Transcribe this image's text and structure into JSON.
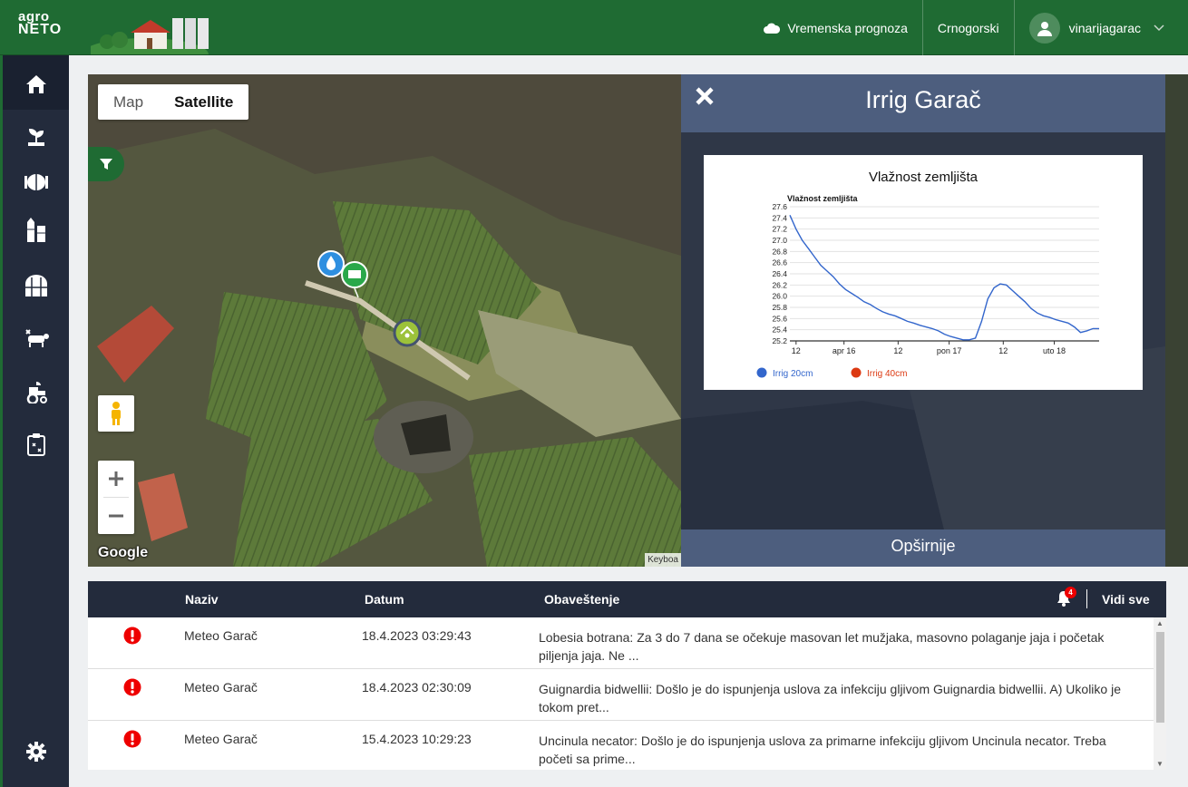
{
  "header": {
    "logo_top": "agro",
    "logo_bottom": "NETO",
    "weather_label": "Vremenska prognoza",
    "language_label": "Crnogorski",
    "username": "vinarijagarac"
  },
  "sidebar": {
    "items": [
      {
        "name": "home-icon"
      },
      {
        "name": "plant-icon"
      },
      {
        "name": "barrel-icon"
      },
      {
        "name": "silo-icon"
      },
      {
        "name": "greenhouse-icon"
      },
      {
        "name": "livestock-icon"
      },
      {
        "name": "tractor-icon"
      },
      {
        "name": "clipboard-icon"
      },
      {
        "name": "gear-icon"
      }
    ]
  },
  "map": {
    "type_map": "Map",
    "type_satellite": "Satellite",
    "google_label": "Google",
    "keyboard_label": "Keyboa"
  },
  "panel": {
    "title": "Irrig Garač",
    "more_button": "Opširnije"
  },
  "chart_data": {
    "type": "line",
    "title": "Vlažnost zemljišta",
    "ylabel": "Vlažnost zemljišta",
    "ylim": [
      25.2,
      27.6
    ],
    "yticks": [
      "27.6",
      "27.4",
      "27.2",
      "27.0",
      "26.8",
      "26.6",
      "26.4",
      "26.2",
      "26.0",
      "25.8",
      "25.6",
      "25.4",
      "25.2"
    ],
    "xticks": [
      "12",
      "apr 16",
      "12",
      "pon 17",
      "12",
      "uto 18"
    ],
    "series": [
      {
        "name": "Irrig 20cm",
        "color": "#3366cc",
        "x": [
          0,
          0.02,
          0.04,
          0.06,
          0.08,
          0.1,
          0.12,
          0.14,
          0.16,
          0.18,
          0.2,
          0.22,
          0.24,
          0.26,
          0.28,
          0.3,
          0.32,
          0.34,
          0.36,
          0.38,
          0.4,
          0.42,
          0.44,
          0.46,
          0.48,
          0.5,
          0.52,
          0.54,
          0.56,
          0.58,
          0.6,
          0.62,
          0.64,
          0.66,
          0.68,
          0.7,
          0.72,
          0.74,
          0.76,
          0.78,
          0.8,
          0.82,
          0.84,
          0.86,
          0.88,
          0.9,
          0.92,
          0.94,
          0.96,
          0.98,
          1.0
        ],
        "values": [
          27.45,
          27.2,
          27.0,
          26.85,
          26.7,
          26.55,
          26.45,
          26.35,
          26.22,
          26.12,
          26.05,
          25.98,
          25.9,
          25.85,
          25.78,
          25.72,
          25.68,
          25.65,
          25.6,
          25.55,
          25.52,
          25.48,
          25.45,
          25.42,
          25.38,
          25.32,
          25.28,
          25.25,
          25.22,
          25.22,
          25.25,
          25.55,
          25.95,
          26.15,
          26.22,
          26.2,
          26.1,
          26.0,
          25.9,
          25.78,
          25.7,
          25.65,
          25.62,
          25.58,
          25.55,
          25.52,
          25.45,
          25.35,
          25.38,
          25.42,
          25.42
        ]
      },
      {
        "name": "Irrig 40cm",
        "color": "#dc3912",
        "x": [],
        "values": []
      }
    ]
  },
  "notifications": {
    "col_name": "Naziv",
    "col_date": "Datum",
    "col_message": "Obaveštenje",
    "bell_count": "4",
    "see_all": "Vidi sve",
    "rows": [
      {
        "name": "Meteo Garač",
        "date": "18.4.2023 03:29:43",
        "message": "Lobesia botrana: Za 3 do 7 dana se očekuje masovan let mužjaka, masovno polaganje jaja i početak piljenja jaja. Ne ..."
      },
      {
        "name": "Meteo Garač",
        "date": "18.4.2023 02:30:09",
        "message": "Guignardia bidwellii: Došlo je do ispunjenja uslova za infekciju gljivom Guignardia bidwellii. A) Ukoliko je tokom pret..."
      },
      {
        "name": "Meteo Garač",
        "date": "15.4.2023 10:29:23",
        "message": "Uncinula necator: Došlo je do ispunjenja uslova za primarne infekciju gljivom Uncinula necator. Treba početi sa prime..."
      }
    ]
  }
}
